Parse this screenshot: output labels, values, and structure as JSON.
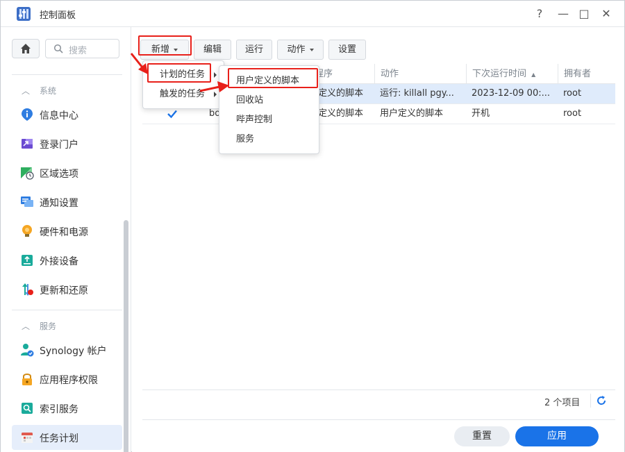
{
  "window": {
    "title": "控制面板",
    "controls": [
      "?",
      "—",
      "□",
      "✕"
    ]
  },
  "sidebar": {
    "search_placeholder": "搜索",
    "sections": [
      {
        "label": "系统",
        "items": [
          {
            "label": "信息中心",
            "icon": "info-icon"
          },
          {
            "label": "登录门户",
            "icon": "login-portal-icon"
          },
          {
            "label": "区域选项",
            "icon": "regional-options-icon"
          },
          {
            "label": "通知设置",
            "icon": "notification-icon"
          },
          {
            "label": "硬件和电源",
            "icon": "hardware-power-icon"
          },
          {
            "label": "外接设备",
            "icon": "external-devices-icon"
          },
          {
            "label": "更新和还原",
            "icon": "update-restore-icon"
          }
        ]
      },
      {
        "label": "服务",
        "items": [
          {
            "label": "Synology 帐户",
            "icon": "synology-account-icon"
          },
          {
            "label": "应用程序权限",
            "icon": "app-privileges-icon"
          },
          {
            "label": "索引服务",
            "icon": "indexing-service-icon"
          },
          {
            "label": "任务计划",
            "icon": "task-scheduler-icon",
            "active": true
          }
        ]
      }
    ]
  },
  "toolbar": {
    "new": "新增",
    "edit": "编辑",
    "run": "运行",
    "action": "动作",
    "settings": "设置"
  },
  "table": {
    "columns": [
      "程序",
      "动作",
      "下次运行时间",
      "拥有者"
    ],
    "rows": [
      {
        "name_fragment": "",
        "program": "定义的脚本",
        "action": "运行: killall pgy...",
        "next_run": "2023-12-09 00:...",
        "owner": "root",
        "selected": true
      },
      {
        "name_fragment": "bo",
        "program": "定义的脚本",
        "action": "用户定义的脚本",
        "next_run": "开机",
        "owner": "root",
        "checked": true
      }
    ]
  },
  "footer": {
    "count": "2 个项目",
    "reset": "重置",
    "apply": "应用"
  },
  "menus": {
    "new_menu": [
      "计划的任务",
      "触发的任务"
    ],
    "sub_menu": [
      "用户定义的脚本",
      "回收站",
      "哔声控制",
      "服务"
    ]
  },
  "colors": {
    "accent": "#1a73e8",
    "highlight": "#e8201a",
    "selected_row": "#dfebfb",
    "active_sidebar": "#e6eefb"
  }
}
